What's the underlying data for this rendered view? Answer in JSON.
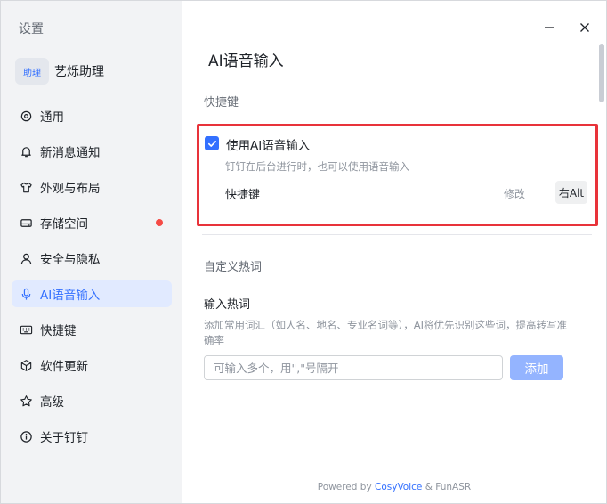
{
  "sidebar": {
    "title": "设置",
    "assistant": {
      "badge": "助理",
      "name": "艺烁助理"
    },
    "items": [
      {
        "label": "通用",
        "icon": "gear-icon"
      },
      {
        "label": "新消息通知",
        "icon": "bell-icon"
      },
      {
        "label": "外观与布局",
        "icon": "shirt-icon"
      },
      {
        "label": "存储空间",
        "icon": "drive-icon",
        "badge_dot": true
      },
      {
        "label": "安全与隐私",
        "icon": "person-icon"
      },
      {
        "label": "AI语音输入",
        "icon": "microphone-icon",
        "active": true
      },
      {
        "label": "快捷键",
        "icon": "keyboard-icon"
      },
      {
        "label": "软件更新",
        "icon": "cube-icon"
      },
      {
        "label": "高级",
        "icon": "star-icon"
      },
      {
        "label": "关于钉钉",
        "icon": "info-icon"
      }
    ]
  },
  "main": {
    "title": "AI语音输入",
    "shortcut_section": {
      "heading": "快捷键",
      "checkbox_label": "使用AI语音输入",
      "checkbox_checked": true,
      "description": "钉钉在后台进行时，也可以使用语音输入",
      "shortcut_label": "快捷键",
      "edit_label": "修改",
      "key": "右Alt"
    },
    "hotwords_section": {
      "heading": "自定义热词",
      "title": "输入热词",
      "description": "添加常用词汇（如人名、地名、专业名词等），AI将优先识别这些词，提高转写准确率",
      "input_placeholder": "可输入多个，用\",\"号隔开",
      "add_label": "添加"
    },
    "footer": {
      "prefix": "Powered by",
      "brand": "CosyVoice",
      "suffix": "& FunASR"
    }
  },
  "colors": {
    "accent": "#3370ff",
    "highlight_border": "#e8333a",
    "badge_dot": "#f54a45",
    "sidebar_bg": "#f2f3f5",
    "active_bg": "#e1eaff"
  }
}
